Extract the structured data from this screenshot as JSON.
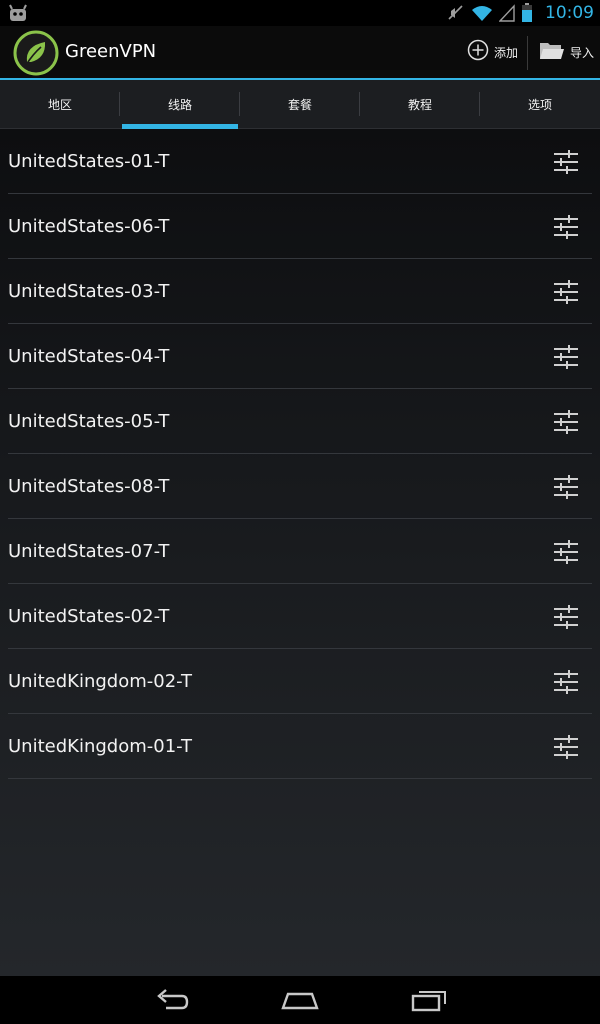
{
  "status_bar": {
    "time": "10:09",
    "icons": [
      "android-icon",
      "mute-icon",
      "wifi-icon",
      "signal-icon",
      "battery-icon"
    ],
    "accent_color": "#33b5e5"
  },
  "action_bar": {
    "title": "GreenVPN",
    "add_label": "添加",
    "import_label": "导入",
    "accent_color": "#33b5e5",
    "logo_color": "#8bc34a"
  },
  "tabs": [
    {
      "label": "地区",
      "selected": false
    },
    {
      "label": "线路",
      "selected": true
    },
    {
      "label": "套餐",
      "selected": false
    },
    {
      "label": "教程",
      "selected": false
    },
    {
      "label": "选项",
      "selected": false
    }
  ],
  "servers": [
    {
      "name": "UnitedStates-01-T"
    },
    {
      "name": "UnitedStates-06-T"
    },
    {
      "name": "UnitedStates-03-T"
    },
    {
      "name": "UnitedStates-04-T"
    },
    {
      "name": "UnitedStates-05-T"
    },
    {
      "name": "UnitedStates-08-T"
    },
    {
      "name": "UnitedStates-07-T"
    },
    {
      "name": "UnitedStates-02-T"
    },
    {
      "name": "UnitedKingdom-02-T"
    },
    {
      "name": "UnitedKingdom-01-T"
    }
  ],
  "nav_bar": {
    "icons": [
      "back-icon",
      "home-icon",
      "recent-apps-icon"
    ]
  }
}
